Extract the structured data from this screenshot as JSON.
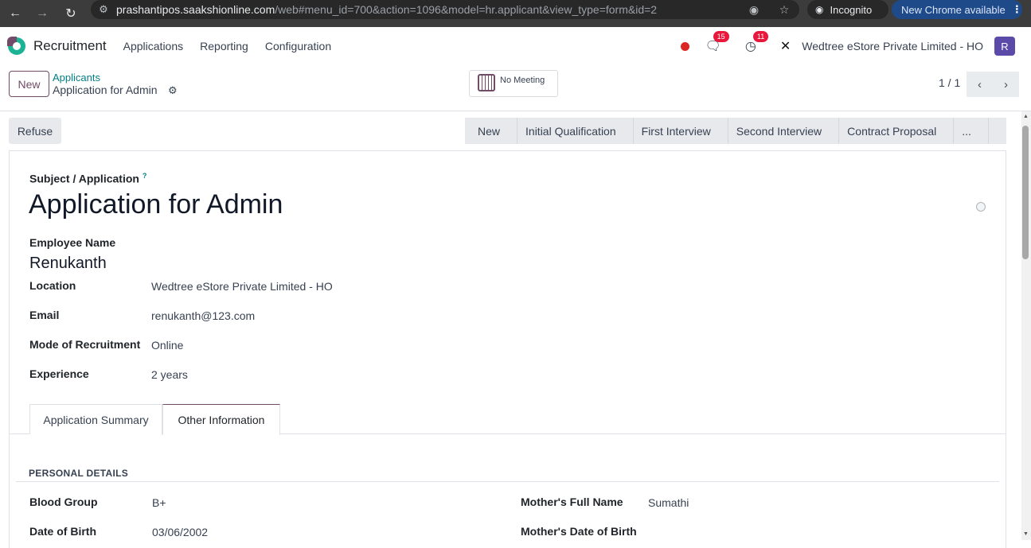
{
  "browser": {
    "url_host": "prashantipos.saakshionline.com",
    "url_path": "/web#menu_id=700&action=1096&model=hr.applicant&view_type=form&id=2",
    "incognito_label": "Incognito",
    "update_label": "New Chrome available"
  },
  "navbar": {
    "app_name": "Recruitment",
    "menu": [
      "Applications",
      "Reporting",
      "Configuration"
    ],
    "messages_count": "15",
    "activities_count": "11",
    "company": "Wedtree eStore Private Limited - HO",
    "avatar_letter": "R"
  },
  "control_panel": {
    "new_label": "New",
    "breadcrumb_parent": "Applicants",
    "breadcrumb_current": "Application for Admin",
    "meeting_label": "No Meeting",
    "pager": "1 / 1"
  },
  "statusbar": {
    "refuse_label": "Refuse",
    "stages": [
      "New",
      "Initial Qualification",
      "First Interview",
      "Second Interview",
      "Contract Proposal",
      "..."
    ]
  },
  "form": {
    "subject_label": "Subject / Application",
    "subject_help": "?",
    "title": "Application for Admin",
    "employee_label": "Employee Name",
    "employee_value": "Renukanth",
    "fields": [
      {
        "label": "Location",
        "value": "Wedtree eStore Private Limited - HO"
      },
      {
        "label": "Email",
        "value": "renukanth@123.com"
      },
      {
        "label": "Mode of Recruitment",
        "value": "Online"
      },
      {
        "label": "Experience",
        "value": "2 years"
      }
    ],
    "tabs": [
      "Application Summary",
      "Other Information"
    ],
    "section_title": "PERSONAL DETAILS",
    "personal_left": [
      {
        "label": "Blood Group",
        "value": "B+"
      },
      {
        "label": "Date of Birth",
        "value": "03/06/2002"
      }
    ],
    "personal_right": [
      {
        "label": "Mother's Full Name",
        "value": "Sumathi"
      },
      {
        "label": "Mother's Date of Birth",
        "value": ""
      }
    ]
  }
}
